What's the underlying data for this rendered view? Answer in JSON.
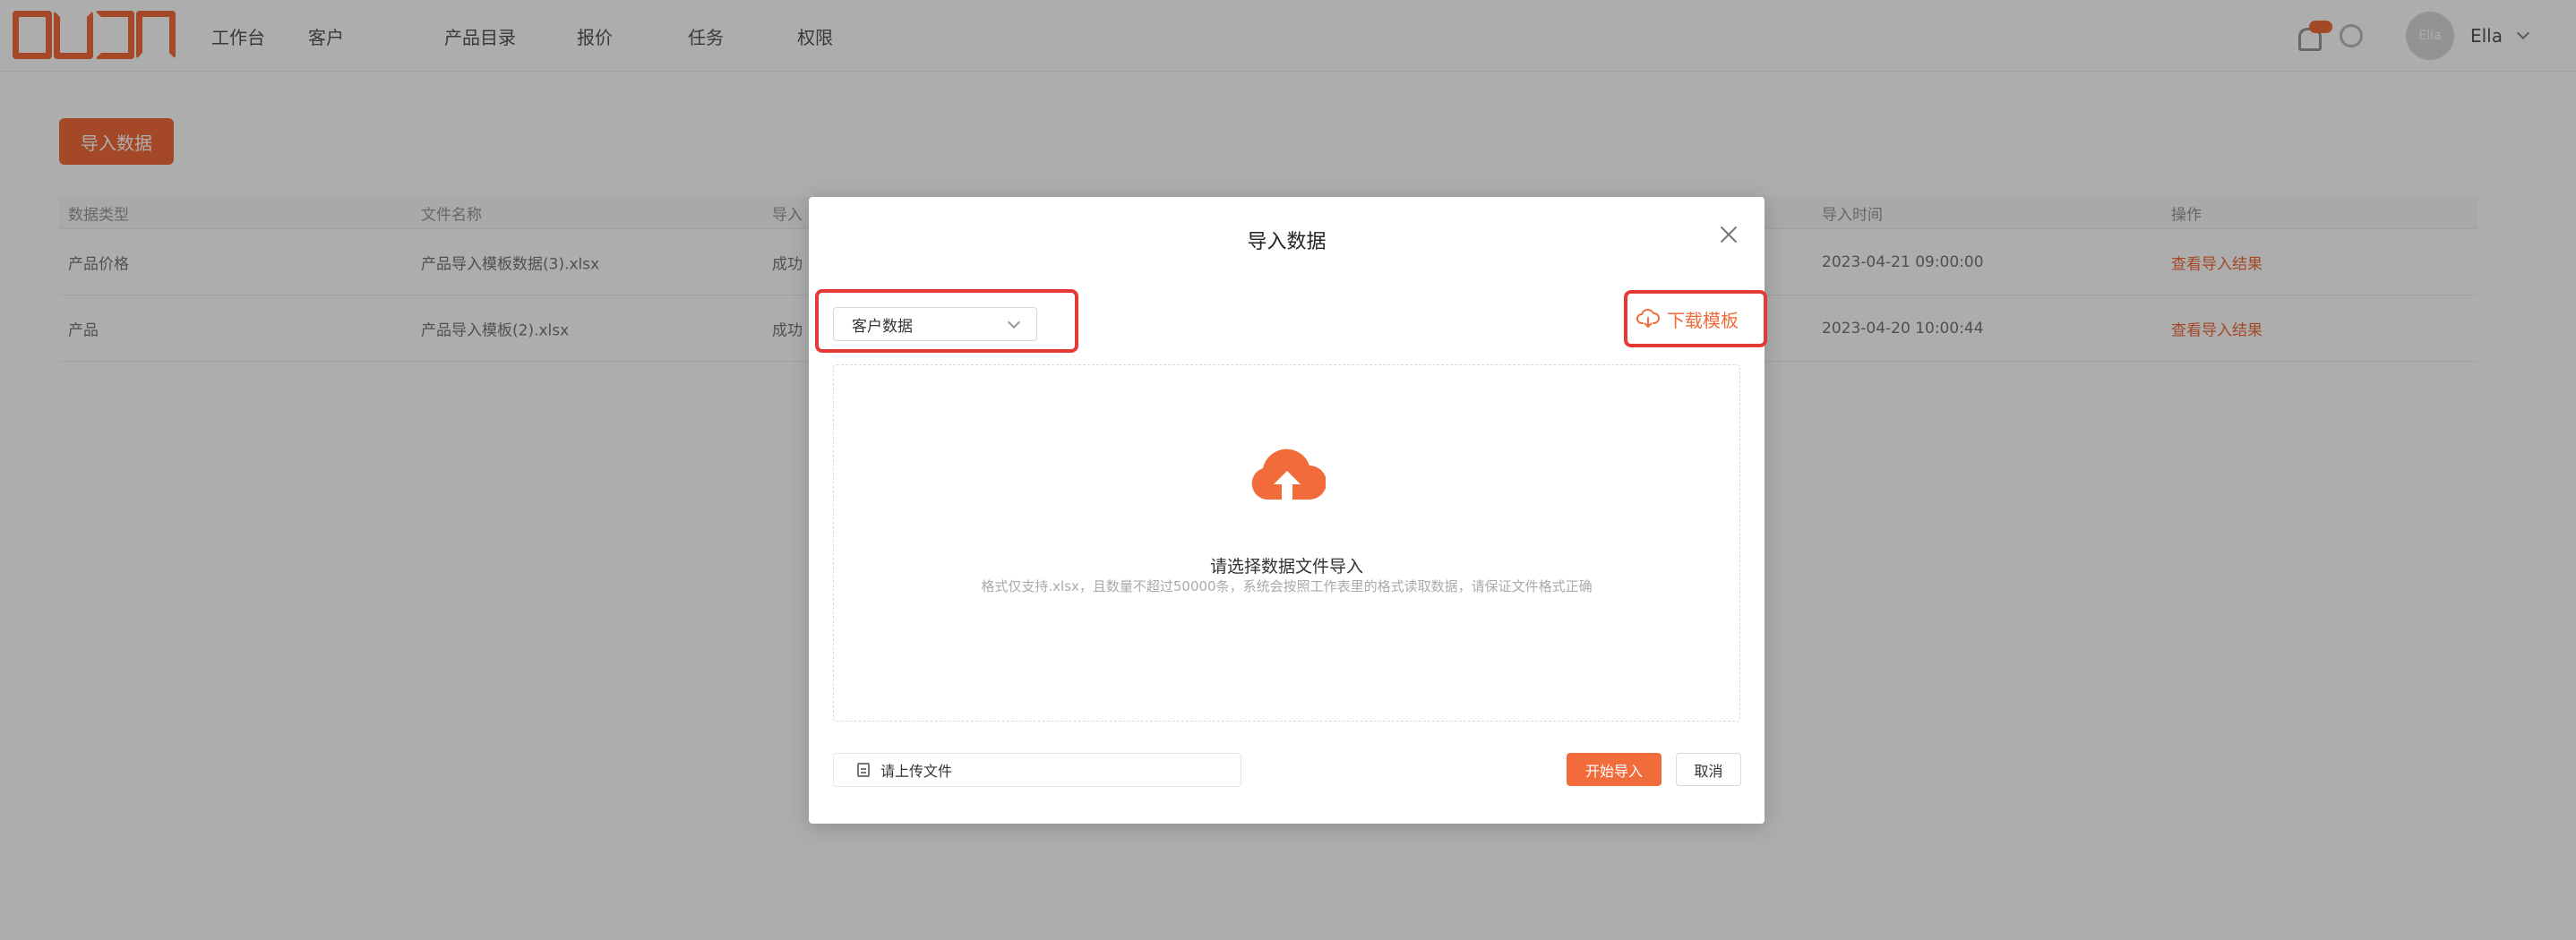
{
  "app": {
    "nav": [
      "工作台",
      "客户",
      "产品目录",
      "报价",
      "任务",
      "权限"
    ],
    "user": {
      "avatar_text": "Ella",
      "name": "Ella"
    }
  },
  "page": {
    "import_button": "导入数据",
    "table": {
      "columns": [
        "数据类型",
        "文件名称",
        "导入",
        "导入时间",
        "操作"
      ],
      "rows": [
        {
          "type": "产品价格",
          "file": "产品导入模板数据(3).xlsx",
          "status": "成功",
          "time": "2023-04-21 09:00:00",
          "action": "查看导入结果"
        },
        {
          "type": "产品",
          "file": "产品导入模板(2).xlsx",
          "status": "成功",
          "time": "2023-04-20 10:00:44",
          "action": "查看导入结果"
        }
      ]
    }
  },
  "modal": {
    "title": "导入数据",
    "select_value": "客户数据",
    "download_template": "下载模板",
    "dropzone_title": "请选择数据文件导入",
    "dropzone_hint": "格式仅支持.xlsx，且数量不超过50000条，系统会按照工作表里的格式读取数据，请保证文件格式正确",
    "file_placeholder": "请上传文件",
    "start_button": "开始导入",
    "cancel_button": "取消"
  },
  "colors": {
    "accent": "#f26b3a",
    "highlight": "#e53935",
    "overlay": "rgba(0,0,0,0.32)"
  },
  "icons": [
    "logo",
    "bell-icon",
    "chevron-down-icon",
    "close-icon",
    "cloud-download-icon",
    "cloud-upload-icon",
    "document-icon"
  ]
}
